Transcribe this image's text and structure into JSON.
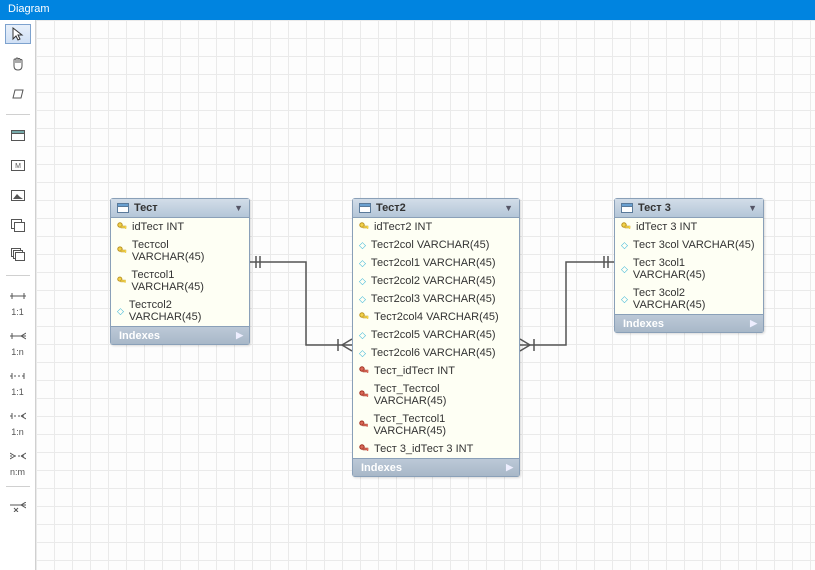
{
  "titlebar": {
    "title": "Diagram"
  },
  "toolbar": {
    "pointer": "pointer-icon",
    "hand": "hand-icon",
    "eraser": "eraser-icon",
    "r1": "1:1",
    "r2": "1:n",
    "r3": "1:1",
    "r4": "1:n",
    "r5": "n:m",
    "r6": ""
  },
  "entities": {
    "t1": {
      "title": "Тест",
      "indexes": "Indexes",
      "cols": [
        {
          "kind": "pk",
          "text": "idТест INT"
        },
        {
          "kind": "pk",
          "text": "Тестcol VARCHAR(45)"
        },
        {
          "kind": "pk",
          "text": "Тестcol1 VARCHAR(45)"
        },
        {
          "kind": "attr",
          "text": "Тестcol2 VARCHAR(45)"
        }
      ]
    },
    "t2": {
      "title": "Тест2",
      "indexes": "Indexes",
      "cols": [
        {
          "kind": "pk",
          "text": "idТест2 INT"
        },
        {
          "kind": "attr",
          "text": "Тест2col VARCHAR(45)"
        },
        {
          "kind": "attr",
          "text": "Тест2col1 VARCHAR(45)"
        },
        {
          "kind": "attr",
          "text": "Тест2col2 VARCHAR(45)"
        },
        {
          "kind": "attr",
          "text": "Тест2col3 VARCHAR(45)"
        },
        {
          "kind": "pk",
          "text": "Тест2col4 VARCHAR(45)"
        },
        {
          "kind": "attr",
          "text": "Тест2col5 VARCHAR(45)"
        },
        {
          "kind": "attr",
          "text": "Тест2col6 VARCHAR(45)"
        },
        {
          "kind": "fk",
          "text": "Тест_idТест INT"
        },
        {
          "kind": "fk",
          "text": "Тест_Тестcol VARCHAR(45)"
        },
        {
          "kind": "fk",
          "text": "Тест_Тестcol1 VARCHAR(45)"
        },
        {
          "kind": "fk",
          "text": "Тест 3_idТест 3 INT"
        }
      ]
    },
    "t3": {
      "title": "Тест 3",
      "indexes": "Indexes",
      "cols": [
        {
          "kind": "pk",
          "text": "idТест 3 INT"
        },
        {
          "kind": "attr",
          "text": "Тест 3col VARCHAR(45)"
        },
        {
          "kind": "attr",
          "text": "Тест 3col1 VARCHAR(45)"
        },
        {
          "kind": "attr",
          "text": "Тест 3col2 VARCHAR(45)"
        }
      ]
    }
  }
}
